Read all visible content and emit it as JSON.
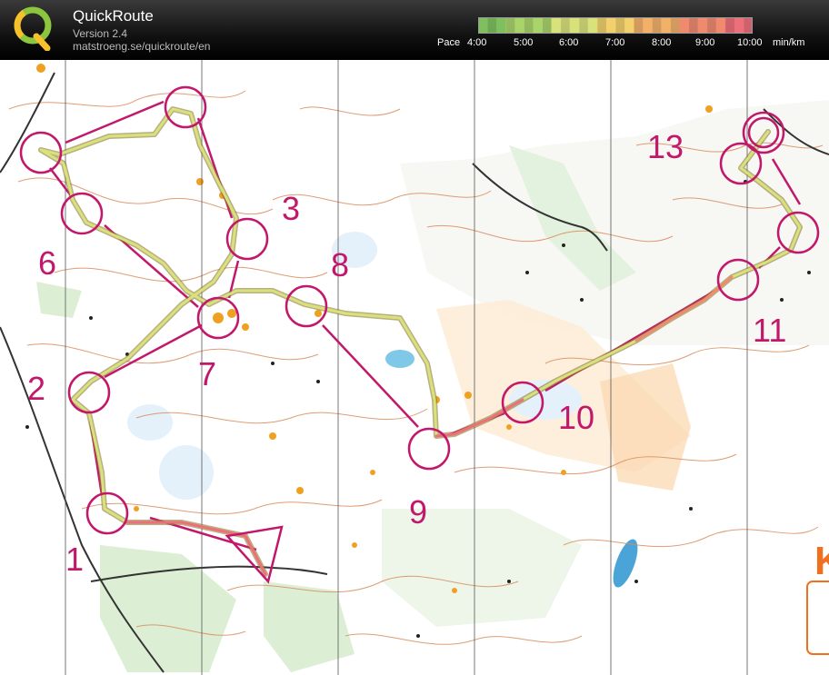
{
  "app": {
    "title": "QuickRoute",
    "version": "Version 2.4",
    "url": "matstroeng.se/quickroute/en"
  },
  "pace": {
    "label": "Pace",
    "ticks": [
      "4:00",
      "5:00",
      "6:00",
      "7:00",
      "8:00",
      "9:00",
      "10:00"
    ],
    "unit": "min/km",
    "colors": [
      "#7fbf5f",
      "#a8d46a",
      "#d9e27a",
      "#f2d06b",
      "#f3b068",
      "#f08a6e",
      "#ec6f7a"
    ]
  },
  "map": {
    "route_color": "#c2186b",
    "control_labels": [
      "1",
      "2",
      "3",
      "6",
      "7",
      "8",
      "9",
      "10",
      "11",
      "13",
      "K"
    ]
  }
}
